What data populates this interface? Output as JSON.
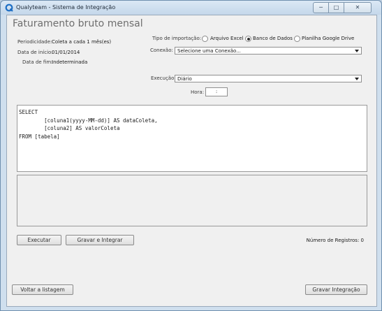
{
  "window": {
    "title": "Qualyteam - Sistema de Integração"
  },
  "page": {
    "title": "Faturamento bruto mensal"
  },
  "info": {
    "periodicity_label": "Periodicidade:",
    "periodicity_value": "Coleta a cada 1 mês(es)",
    "start_label": "Data de início:",
    "start_value": "01/01/2014",
    "end_label": "Data de fim:",
    "end_value": "Indeterminada"
  },
  "import": {
    "label": "Tipo de importação:",
    "options": [
      "Arquivo Excel",
      "Banco de Dados",
      "Planilha Google Drive"
    ],
    "selected": "Banco de Dados"
  },
  "connection": {
    "label": "Conexão:",
    "value": "Selecione uma Conexão..."
  },
  "execution": {
    "label": "Execução:",
    "value": "Diário",
    "hour_label": "Hora:",
    "hour_value": ":"
  },
  "sql": {
    "text": "SELECT\n        [coluna1(yyyy-MM-dd)] AS dataColeta,\n        [coluna2] AS valorColeta\nFROM [tabela]"
  },
  "buttons": {
    "execute": "Executar",
    "save_integrate": "Gravar e Integrar",
    "back": "Voltar a listagem",
    "save": "Gravar Integração"
  },
  "records": {
    "label": "Número de Registros: 0"
  }
}
